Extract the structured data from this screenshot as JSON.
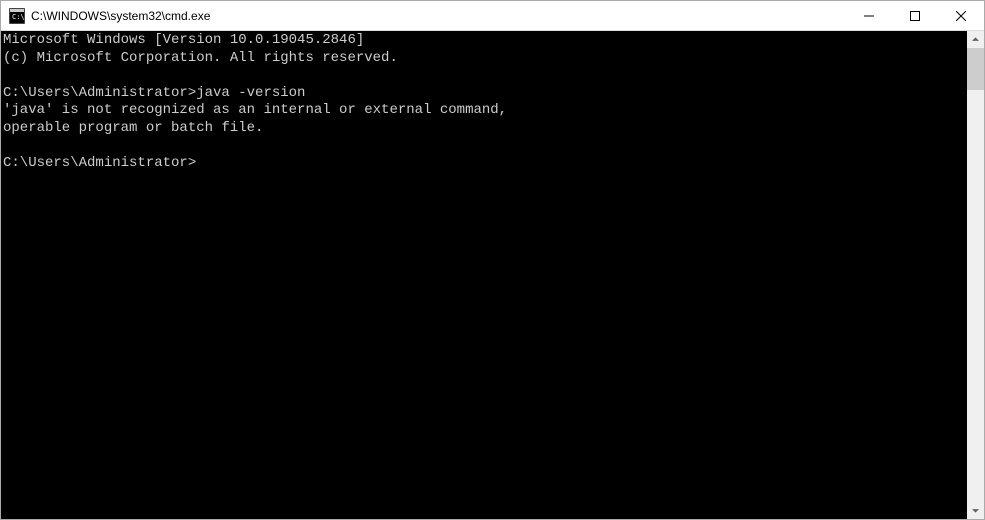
{
  "window": {
    "title": "C:\\WINDOWS\\system32\\cmd.exe"
  },
  "terminal": {
    "lines": [
      "Microsoft Windows [Version 10.0.19045.2846]",
      "(c) Microsoft Corporation. All rights reserved.",
      "",
      "C:\\Users\\Administrator>java -version",
      "'java' is not recognized as an internal or external command,",
      "operable program or batch file.",
      "",
      "C:\\Users\\Administrator>"
    ]
  }
}
